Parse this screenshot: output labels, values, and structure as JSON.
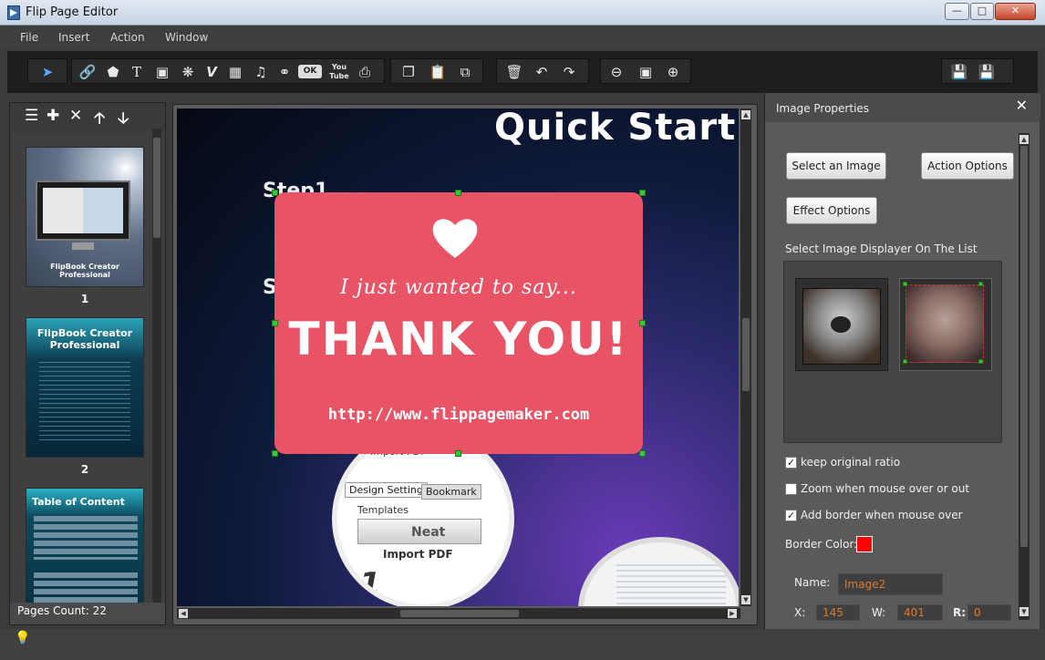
{
  "window": {
    "title": "Flip Page Editor"
  },
  "menu": [
    "File",
    "Insert",
    "Action",
    "Window"
  ],
  "toolbar": {
    "ok_label": "OK",
    "youtube_label": "You Tube"
  },
  "pages_panel": {
    "pages": [
      {
        "number": "1",
        "caption": "FlipBook Creator Professional"
      },
      {
        "number": "2",
        "caption": "FlipBook Creator Professional"
      },
      {
        "number": "3",
        "caption": "Table of Content"
      }
    ],
    "pages_count": "Pages Count: 22"
  },
  "canvas": {
    "heading": "Quick Start of F",
    "step1": "Step1",
    "step2": "S",
    "card": {
      "script": "I just wanted to say...",
      "thanks": "THANK YOU!",
      "url": "http://www.flippagemaker.com"
    },
    "circle": {
      "import_pdf": "Import PDF",
      "tab1": "Design Setting",
      "tab2": "Bookmark",
      "templates": "Templates",
      "neat": "Neat",
      "import_pdf2": "Import PDF",
      "num": "1"
    }
  },
  "properties": {
    "title": "Image Properties",
    "select_image": "Select an Image",
    "action_options": "Action Options",
    "effect_options": "Effect Options",
    "displayer_label": "Select Image Displayer On The List",
    "keep_ratio": "keep original ratio",
    "keep_ratio_checked": true,
    "zoom_label": "Zoom when mouse over or out",
    "zoom_checked": false,
    "border_label": "Add border when mouse over",
    "border_checked": true,
    "border_color_label": "Border Color:",
    "border_color": "#ff0000",
    "name_label": "Name:",
    "name_value": "Image2",
    "x_label": "X:",
    "x_value": "145",
    "w_label": "W:",
    "w_value": "401",
    "r_label": "R:",
    "r_value": "0"
  }
}
